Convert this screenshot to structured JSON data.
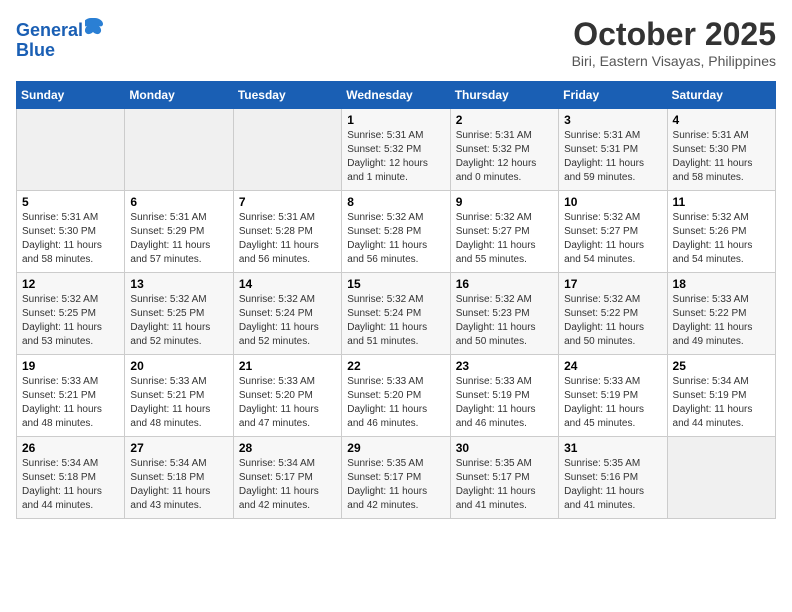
{
  "header": {
    "logo_line1": "General",
    "logo_line2": "Blue",
    "month": "October 2025",
    "location": "Biri, Eastern Visayas, Philippines"
  },
  "weekdays": [
    "Sunday",
    "Monday",
    "Tuesday",
    "Wednesday",
    "Thursday",
    "Friday",
    "Saturday"
  ],
  "rows": [
    [
      {
        "day": "",
        "text": ""
      },
      {
        "day": "",
        "text": ""
      },
      {
        "day": "",
        "text": ""
      },
      {
        "day": "1",
        "text": "Sunrise: 5:31 AM\nSunset: 5:32 PM\nDaylight: 12 hours\nand 1 minute."
      },
      {
        "day": "2",
        "text": "Sunrise: 5:31 AM\nSunset: 5:32 PM\nDaylight: 12 hours\nand 0 minutes."
      },
      {
        "day": "3",
        "text": "Sunrise: 5:31 AM\nSunset: 5:31 PM\nDaylight: 11 hours\nand 59 minutes."
      },
      {
        "day": "4",
        "text": "Sunrise: 5:31 AM\nSunset: 5:30 PM\nDaylight: 11 hours\nand 58 minutes."
      }
    ],
    [
      {
        "day": "5",
        "text": "Sunrise: 5:31 AM\nSunset: 5:30 PM\nDaylight: 11 hours\nand 58 minutes."
      },
      {
        "day": "6",
        "text": "Sunrise: 5:31 AM\nSunset: 5:29 PM\nDaylight: 11 hours\nand 57 minutes."
      },
      {
        "day": "7",
        "text": "Sunrise: 5:31 AM\nSunset: 5:28 PM\nDaylight: 11 hours\nand 56 minutes."
      },
      {
        "day": "8",
        "text": "Sunrise: 5:32 AM\nSunset: 5:28 PM\nDaylight: 11 hours\nand 56 minutes."
      },
      {
        "day": "9",
        "text": "Sunrise: 5:32 AM\nSunset: 5:27 PM\nDaylight: 11 hours\nand 55 minutes."
      },
      {
        "day": "10",
        "text": "Sunrise: 5:32 AM\nSunset: 5:27 PM\nDaylight: 11 hours\nand 54 minutes."
      },
      {
        "day": "11",
        "text": "Sunrise: 5:32 AM\nSunset: 5:26 PM\nDaylight: 11 hours\nand 54 minutes."
      }
    ],
    [
      {
        "day": "12",
        "text": "Sunrise: 5:32 AM\nSunset: 5:25 PM\nDaylight: 11 hours\nand 53 minutes."
      },
      {
        "day": "13",
        "text": "Sunrise: 5:32 AM\nSunset: 5:25 PM\nDaylight: 11 hours\nand 52 minutes."
      },
      {
        "day": "14",
        "text": "Sunrise: 5:32 AM\nSunset: 5:24 PM\nDaylight: 11 hours\nand 52 minutes."
      },
      {
        "day": "15",
        "text": "Sunrise: 5:32 AM\nSunset: 5:24 PM\nDaylight: 11 hours\nand 51 minutes."
      },
      {
        "day": "16",
        "text": "Sunrise: 5:32 AM\nSunset: 5:23 PM\nDaylight: 11 hours\nand 50 minutes."
      },
      {
        "day": "17",
        "text": "Sunrise: 5:32 AM\nSunset: 5:22 PM\nDaylight: 11 hours\nand 50 minutes."
      },
      {
        "day": "18",
        "text": "Sunrise: 5:33 AM\nSunset: 5:22 PM\nDaylight: 11 hours\nand 49 minutes."
      }
    ],
    [
      {
        "day": "19",
        "text": "Sunrise: 5:33 AM\nSunset: 5:21 PM\nDaylight: 11 hours\nand 48 minutes."
      },
      {
        "day": "20",
        "text": "Sunrise: 5:33 AM\nSunset: 5:21 PM\nDaylight: 11 hours\nand 48 minutes."
      },
      {
        "day": "21",
        "text": "Sunrise: 5:33 AM\nSunset: 5:20 PM\nDaylight: 11 hours\nand 47 minutes."
      },
      {
        "day": "22",
        "text": "Sunrise: 5:33 AM\nSunset: 5:20 PM\nDaylight: 11 hours\nand 46 minutes."
      },
      {
        "day": "23",
        "text": "Sunrise: 5:33 AM\nSunset: 5:19 PM\nDaylight: 11 hours\nand 46 minutes."
      },
      {
        "day": "24",
        "text": "Sunrise: 5:33 AM\nSunset: 5:19 PM\nDaylight: 11 hours\nand 45 minutes."
      },
      {
        "day": "25",
        "text": "Sunrise: 5:34 AM\nSunset: 5:19 PM\nDaylight: 11 hours\nand 44 minutes."
      }
    ],
    [
      {
        "day": "26",
        "text": "Sunrise: 5:34 AM\nSunset: 5:18 PM\nDaylight: 11 hours\nand 44 minutes."
      },
      {
        "day": "27",
        "text": "Sunrise: 5:34 AM\nSunset: 5:18 PM\nDaylight: 11 hours\nand 43 minutes."
      },
      {
        "day": "28",
        "text": "Sunrise: 5:34 AM\nSunset: 5:17 PM\nDaylight: 11 hours\nand 42 minutes."
      },
      {
        "day": "29",
        "text": "Sunrise: 5:35 AM\nSunset: 5:17 PM\nDaylight: 11 hours\nand 42 minutes."
      },
      {
        "day": "30",
        "text": "Sunrise: 5:35 AM\nSunset: 5:17 PM\nDaylight: 11 hours\nand 41 minutes."
      },
      {
        "day": "31",
        "text": "Sunrise: 5:35 AM\nSunset: 5:16 PM\nDaylight: 11 hours\nand 41 minutes."
      },
      {
        "day": "",
        "text": ""
      }
    ]
  ]
}
